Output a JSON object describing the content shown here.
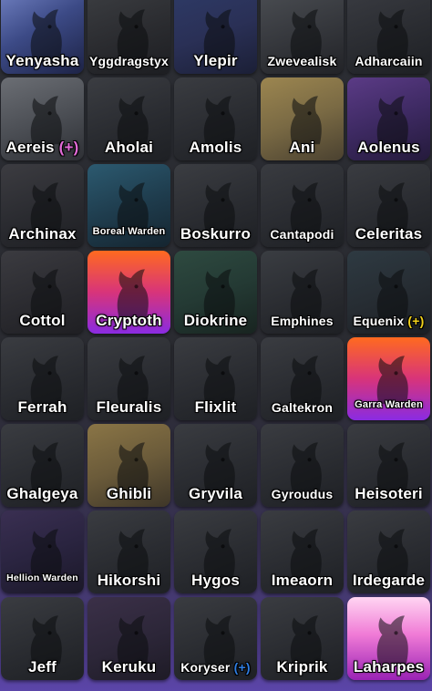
{
  "tiles": [
    {
      "name": "Yenyasha",
      "bg": "linear-gradient(150deg,#6f7fc0 0%,#3c4a86 45%,#1d2346 100%)",
      "size": "",
      "badge": ""
    },
    {
      "name": "Yggdragstyx",
      "bg": "linear-gradient(160deg,#3b3d41 0%,#2a2b2f 55%,#1d1e22 100%)",
      "size": "sm",
      "badge": ""
    },
    {
      "name": "Ylepir",
      "bg": "linear-gradient(160deg,#2e3a66 0%,#2a3056 50%,#1b1f36 100%)",
      "size": "",
      "badge": ""
    },
    {
      "name": "Zwevealisk",
      "bg": "linear-gradient(160deg,#4a4d52 0%,#34363b 55%,#222327 100%)",
      "size": "sm",
      "badge": ""
    },
    {
      "name": "Adharcaiin",
      "bg": "linear-gradient(160deg,#393b41 0%,#2a2c31 55%,#1e2024 100%)",
      "size": "sm",
      "badge": ""
    },
    {
      "name": "Aereis",
      "bg": "linear-gradient(160deg,#6b6e74 0%,#4a4d53 55%,#2e3035 100%)",
      "size": "",
      "badge": "(+)",
      "badgeColor": "#e26bd7"
    },
    {
      "name": "Aholai",
      "bg": "linear-gradient(160deg,#3b3d42 0%,#2a2c31 55%,#1e2024 100%)",
      "size": "",
      "badge": ""
    },
    {
      "name": "Amolis",
      "bg": "linear-gradient(160deg,#3a3c41 0%,#2a2c31 55%,#1e2024 100%)",
      "size": "",
      "badge": ""
    },
    {
      "name": "Ani",
      "bg": "linear-gradient(160deg,#9c8650 0%,#7a6a44 50%,#4a4130 100%)",
      "size": "",
      "badge": ""
    },
    {
      "name": "Aolenus",
      "bg": "linear-gradient(160deg,#5b3b86 0%,#3e2a63 50%,#241a3b 100%)",
      "size": "",
      "badge": ""
    },
    {
      "name": "Archinax",
      "bg": "linear-gradient(160deg,#3c3c41 0%,#2a2b30 55%,#1e1f23 100%)",
      "size": "",
      "badge": ""
    },
    {
      "name": "Boreal Warden",
      "bg": "linear-gradient(160deg,#2c5a70 0%,#1f3d4e 50%,#152530 100%)",
      "size": "xs",
      "badge": ""
    },
    {
      "name": "Boskurro",
      "bg": "linear-gradient(160deg,#3b3d42 0%,#2a2c31 55%,#1e2024 100%)",
      "size": "",
      "badge": ""
    },
    {
      "name": "Cantapodi",
      "bg": "linear-gradient(160deg,#393b40 0%,#2a2c31 55%,#1e2024 100%)",
      "size": "sm",
      "badge": ""
    },
    {
      "name": "Celeritas",
      "bg": "linear-gradient(160deg,#3a3c41 0%,#2a2c31 55%,#1e2024 100%)",
      "size": "",
      "badge": ""
    },
    {
      "name": "Cottol",
      "bg": "linear-gradient(160deg,#3b3b40 0%,#2b2b30 55%,#1f1f23 100%)",
      "size": "",
      "badge": ""
    },
    {
      "name": "Cryptoth",
      "bg": "linear-gradient(180deg,#ff6a1f 0%,#d8347a 50%,#8a2be2 100%)",
      "size": "",
      "badge": ""
    },
    {
      "name": "Diokrine",
      "bg": "linear-gradient(160deg,#2e4a40 0%,#243a34 50%,#182420 100%)",
      "size": "",
      "badge": ""
    },
    {
      "name": "Emphines",
      "bg": "linear-gradient(160deg,#3a3d42 0%,#2a2c31 55%,#1e2024 100%)",
      "size": "sm",
      "badge": ""
    },
    {
      "name": "Equenix",
      "bg": "linear-gradient(160deg,#2e3a42 0%,#262c32 55%,#1b1f24 100%)",
      "size": "sm",
      "badge": "(+)",
      "badgeColor": "#f2d21b"
    },
    {
      "name": "Ferrah",
      "bg": "linear-gradient(160deg,#3a3c41 0%,#2a2c31 55%,#1e2024 100%)",
      "size": "",
      "badge": ""
    },
    {
      "name": "Fleuralis",
      "bg": "linear-gradient(160deg,#3a3c41 0%,#2a2c31 55%,#1e2024 100%)",
      "size": "",
      "badge": ""
    },
    {
      "name": "Flixlit",
      "bg": "linear-gradient(160deg,#3a3c41 0%,#2a2c31 55%,#1e2024 100%)",
      "size": "",
      "badge": ""
    },
    {
      "name": "Galtekron",
      "bg": "linear-gradient(160deg,#3a3c41 0%,#2a2c31 55%,#1e2024 100%)",
      "size": "sm",
      "badge": ""
    },
    {
      "name": "Garra Warden",
      "bg": "linear-gradient(180deg,#ff6a1f 0%,#d8347a 50%,#8a2be2 100%)",
      "size": "xs",
      "badge": ""
    },
    {
      "name": "Ghalgeya",
      "bg": "linear-gradient(160deg,#3a3c41 0%,#2a2c31 55%,#1e2024 100%)",
      "size": "",
      "badge": ""
    },
    {
      "name": "Ghibli",
      "bg": "linear-gradient(160deg,#8a7546 0%,#6b5b3a 50%,#3e3628 100%)",
      "size": "",
      "badge": ""
    },
    {
      "name": "Gryvila",
      "bg": "linear-gradient(160deg,#3a3c41 0%,#2a2c31 55%,#1e2024 100%)",
      "size": "",
      "badge": ""
    },
    {
      "name": "Gyroudus",
      "bg": "linear-gradient(160deg,#3a3c41 0%,#2a2c31 55%,#1e2024 100%)",
      "size": "sm",
      "badge": ""
    },
    {
      "name": "Heisoteri",
      "bg": "linear-gradient(160deg,#3a3c41 0%,#2a2c31 55%,#1e2024 100%)",
      "size": "",
      "badge": ""
    },
    {
      "name": "Hellion Warden",
      "bg": "linear-gradient(160deg,#3a2f52 0%,#2a2440 50%,#1b1828 100%)",
      "size": "xxs",
      "badge": ""
    },
    {
      "name": "Hikorshi",
      "bg": "linear-gradient(160deg,#3a3c41 0%,#2a2c31 55%,#1e2024 100%)",
      "size": "",
      "badge": ""
    },
    {
      "name": "Hygos",
      "bg": "linear-gradient(160deg,#3a3c41 0%,#2a2c31 55%,#1e2024 100%)",
      "size": "",
      "badge": ""
    },
    {
      "name": "Imeaorn",
      "bg": "linear-gradient(160deg,#3a3c41 0%,#2a2c31 55%,#1e2024 100%)",
      "size": "",
      "badge": ""
    },
    {
      "name": "Irdegarde",
      "bg": "linear-gradient(160deg,#3a3c41 0%,#2a2c31 55%,#1e2024 100%)",
      "size": "",
      "badge": ""
    },
    {
      "name": "Jeff",
      "bg": "linear-gradient(160deg,#3a3c41 0%,#2a2c31 55%,#1e2024 100%)",
      "size": "",
      "badge": ""
    },
    {
      "name": "Keruku",
      "bg": "linear-gradient(160deg,#3b3048 0%,#2c2638 55%,#1e1b26 100%)",
      "size": "",
      "badge": ""
    },
    {
      "name": "Koryser",
      "bg": "linear-gradient(160deg,#3a3c41 0%,#2a2c31 55%,#1e2024 100%)",
      "size": "sm",
      "badge": "(+)",
      "badgeColor": "#2f7de1"
    },
    {
      "name": "Kriprik",
      "bg": "linear-gradient(160deg,#3a3c41 0%,#2a2c31 55%,#1e2024 100%)",
      "size": "",
      "badge": ""
    },
    {
      "name": "Laharpes",
      "bg": "linear-gradient(180deg,#ffd5f2 0%,#f07bd6 45%,#9a22b5 100%)",
      "size": "",
      "badge": ""
    }
  ]
}
